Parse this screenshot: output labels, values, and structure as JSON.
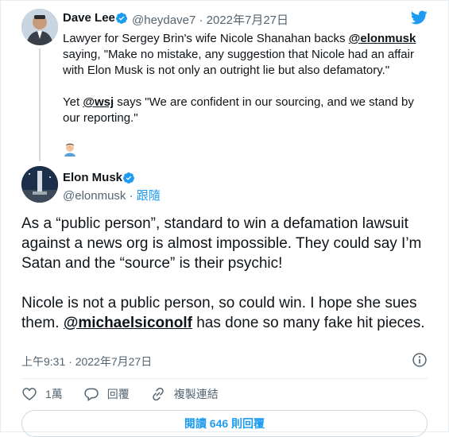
{
  "parent": {
    "name": "Dave Lee",
    "handle_time": "@heydave7 · 2022年7月27日",
    "para1_pre": "Lawyer for Sergey Brin's wife Nicole Shanahan backs ",
    "para1_mention": "@elonmusk",
    "para1_post": " saying, \"Make no mistake, any suggestion that Nicole had an affair with Elon Musk is not only an outright lie but also defamatory.\"",
    "para2_pre": "Yet ",
    "para2_mention": "@wsj",
    "para2_post": " says \"We are confident in our sourcing, and we stand by our reporting.\""
  },
  "main": {
    "name": "Elon Musk",
    "handle": "@elonmusk",
    "separator": " · ",
    "follow": "跟隨",
    "para1": "As a “public person”, standard to win a defamation lawsuit against a news org is almost impossible. They could say I’m Satan and the “source” is their psychic!",
    "para2_pre": "Nicole is not a public person, so could win. I hope she sues them. ",
    "para2_mention": "@michaelsiconolf",
    "para2_post": " has done so many fake hit pieces.",
    "timestamp": "上午9:31 · 2022年7月27日"
  },
  "actions": {
    "like_count": "1萬",
    "reply_label": "回覆",
    "copy_link_label": "複製連結"
  },
  "reply_button": "閱讀 646 則回覆",
  "colors": {
    "accent": "#1d9bf0",
    "text": "#0f1419",
    "muted": "#536471"
  }
}
